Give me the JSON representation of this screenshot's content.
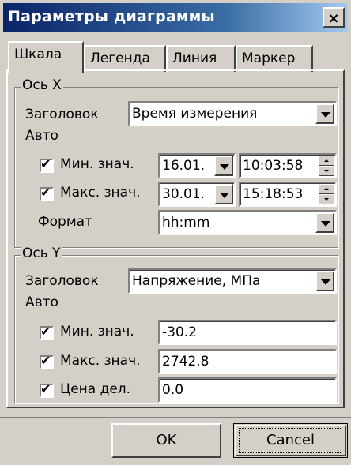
{
  "window": {
    "title": "Параметры диаграммы",
    "close_glyph": "×"
  },
  "tabs": [
    {
      "label": "Шкала",
      "active": true
    },
    {
      "label": "Легенда",
      "active": false
    },
    {
      "label": "Линия",
      "active": false
    },
    {
      "label": "Маркер",
      "active": false
    }
  ],
  "axis_x": {
    "group_label": "Ось X",
    "title_label": "Заголовок",
    "title_value": "Время измерения",
    "auto_label": "Авто",
    "min": {
      "label": "Мин. знач.",
      "checked": true,
      "date": "16.01.",
      "time": "10:03:58"
    },
    "max": {
      "label": "Макс. знач.",
      "checked": true,
      "date": "30.01.",
      "time": "15:18:53"
    },
    "format_label": "Формат",
    "format_value": "hh:mm"
  },
  "axis_y": {
    "group_label": "Ось Y",
    "title_label": "Заголовок",
    "title_value": "Напряжение, МПа",
    "auto_label": "Авто",
    "min": {
      "label": "Мин. знач.",
      "checked": true,
      "value": "-30.2"
    },
    "max": {
      "label": "Макс. знач.",
      "checked": true,
      "value": "2742.8"
    },
    "step": {
      "label": "Цена дел.",
      "checked": true,
      "value": "0.0"
    }
  },
  "buttons": {
    "ok": "OK",
    "cancel": "Cancel"
  },
  "check_glyph": "✔"
}
